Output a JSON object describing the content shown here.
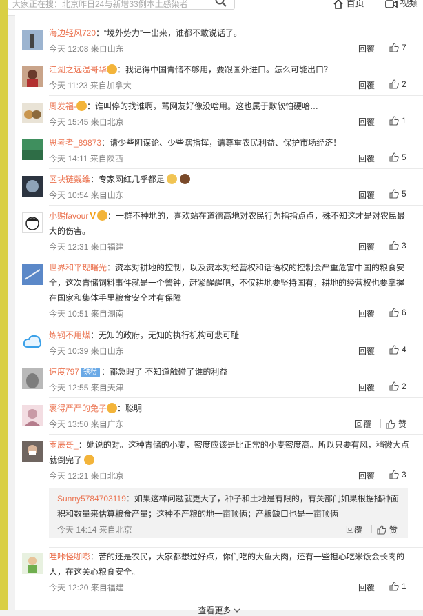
{
  "search": {
    "placeholder": "大家正在搜：北京昨日24与新增33例本土感染者"
  },
  "nav": {
    "home": "首页",
    "video": "视频"
  },
  "comments": [
    {
      "user": "海边轻风720",
      "text": "“境外势力”一出来，谁都不敢说话了。",
      "meta": "今天 12:08 来自山东",
      "likes": "7"
    },
    {
      "user": "江湖之远温哥华",
      "text": "我记得中国青储不够用，要跟国外进口。怎么可能出口？",
      "meta": "今天 11:23 来自加拿大",
      "likes": "2"
    },
    {
      "user": "周发福-",
      "text": "谁叫停的找谁啊，骂网友好像没啥用。这也属于欺软怕硬哈…",
      "meta": "今天 15:45 来自北京",
      "likes": "1"
    },
    {
      "user": "思考者_89873",
      "text": "请少些阴谋论、少些瞎指挥，请尊重农民利益、保护市场经济！",
      "meta": "今天 14:11 来自陕西",
      "likes": "5"
    },
    {
      "user": "区块链戴维",
      "text": "专家网红几乎都是",
      "meta": "今天 10:54 来自山东",
      "likes": "5"
    },
    {
      "user": "小赐favour",
      "text": "一群不种地的，喜欢站在道德高地对农民行为指指点点，殊不知这才是对农民最大的伤害。",
      "meta": "今天 12:31 来自福建",
      "likes": "3"
    },
    {
      "user": "世界和平现曙光",
      "text": "资本对耕地的控制，以及资本对经营权和话语权的控制会严重危害中国的粮食安全，这次青储饲料事件就是一个警钟，赶紧醒醒吧，不仅耕地要坚持国有，耕地的经营权也要掌握在国家和集体手里粮食安全才有保障",
      "meta": "今天 10:51 来自湖南",
      "likes": "6"
    },
    {
      "user": "炼钢不用煤",
      "text": "无知的政府，无知的执行机构可悲可耻",
      "meta": "今天 10:39 来自山东",
      "likes": "4"
    },
    {
      "user": "速度797",
      "badge": "铁粉",
      "text": "都急眼了 不知道触碰了谁的利益",
      "meta": "今天 12:55 来自天津",
      "likes": "2"
    },
    {
      "user": "裹得严严的兔子",
      "text": "聪明",
      "meta": "今天 13:50 来自广东",
      "likes": "赞"
    },
    {
      "user": "雨辰哥_",
      "text": "她说的对。这种青储的小麦，密度应该是比正常的小麦密度高。所以只要有风，稍微大点就倒完了",
      "meta": "今天 12:21 来自北京",
      "likes": "3"
    },
    {
      "user": "哇咔怪咖嘭",
      "text": "苦的还是农民，大家都想过好点，你们吃的大鱼大肉，还有一些担心吃米饭会长肉的人，在这关心粮食安全。",
      "meta": "今天 12:20 来自福建",
      "likes": "1"
    }
  ],
  "subreply": {
    "user": "Sunny5784703119",
    "text": "如果这样问题就更大了，种子和土地是有限的，有关部门如果根据播种面积和数量来估算粮食产量；这种不产粮的地一亩顶俩；产粮缺口也是一亩顶俩",
    "meta": "今天 14:14 来自北京",
    "likes": "赞"
  },
  "labels": {
    "reply": "回覆",
    "sep": "：",
    "more": "查看更多"
  },
  "colors": {
    "username": "#eb7350",
    "accent_bar": "#d9cf45"
  }
}
